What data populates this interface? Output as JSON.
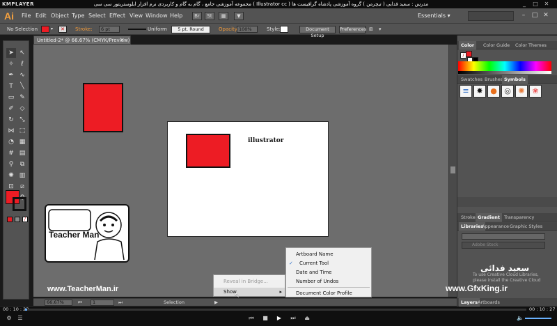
{
  "player": {
    "name": "KMPLAYER",
    "title": "مجموعه آموزشی جامع ، گام به گام و کاربردی نرم افزار ایلوستریتور سی سی ( Illustrator cc )   مدرس : سعید فدایی ( تیچرمن ) گروه آموزشی پادشاه گرافیست ها",
    "time_current": "00 : 10 : 23",
    "time_total": "00 : 10 : 27",
    "progress": 0.004
  },
  "menubar": {
    "logo": "Ai",
    "items": [
      "File",
      "Edit",
      "Object",
      "Type",
      "Select",
      "Effect",
      "View",
      "Window",
      "Help"
    ],
    "workspace": "Essentials"
  },
  "controlbar": {
    "selection": "No Selection",
    "stroke_label": "Stroke:",
    "stroke_value": "6 pt",
    "profile": "Uniform",
    "brush": "5 pt. Round",
    "opacity_label": "Opacity:",
    "opacity_value": "100%",
    "style_label": "Style:",
    "document_setup": "Document Setup",
    "preferences": "Preferences",
    "fill_color": "#ed1c24"
  },
  "document": {
    "tab": "Untitled-2* @ 66.67% (CMYK/Preview)",
    "artboard_text": "illustrator"
  },
  "statusbar": {
    "zoom": "66.67%",
    "artboard_num": "1",
    "tool": "Selection"
  },
  "context_menu": {
    "items": [
      {
        "label": "Reveal in Bridge...",
        "disabled": true
      },
      {
        "label": "Show",
        "submenu": true
      }
    ]
  },
  "submenu": {
    "items": [
      {
        "label": "Artboard Name",
        "checked": false
      },
      {
        "label": "Current Tool",
        "checked": true
      },
      {
        "label": "Date and Time",
        "checked": false
      },
      {
        "label": "Number of Undos",
        "checked": false
      },
      {
        "label": "Document Color Profile",
        "checked": false
      }
    ]
  },
  "panels": {
    "color_tabs": [
      "Color",
      "Color Guide",
      "Color Themes"
    ],
    "swatch_tabs": [
      "Swatches",
      "Brushes",
      "Symbols"
    ],
    "stroke_tabs": [
      "Stroke",
      "Gradient",
      "Transparency"
    ],
    "library_tabs": [
      "Libraries",
      "Appearance",
      "Graphic Styles"
    ],
    "library_message": "To use Creative Cloud Libraries, please install the Creative Cloud",
    "library_search": "Adobe Stock",
    "layer_tabs": [
      "Layers",
      "Artboards"
    ]
  },
  "watermarks": {
    "teacherman_name": "Teacher Man",
    "teacherman_url": "www.TeacherMan.ir",
    "gfxking_url": "www.GfxKing.ir",
    "gfxking_name": "سعید فدائی"
  }
}
